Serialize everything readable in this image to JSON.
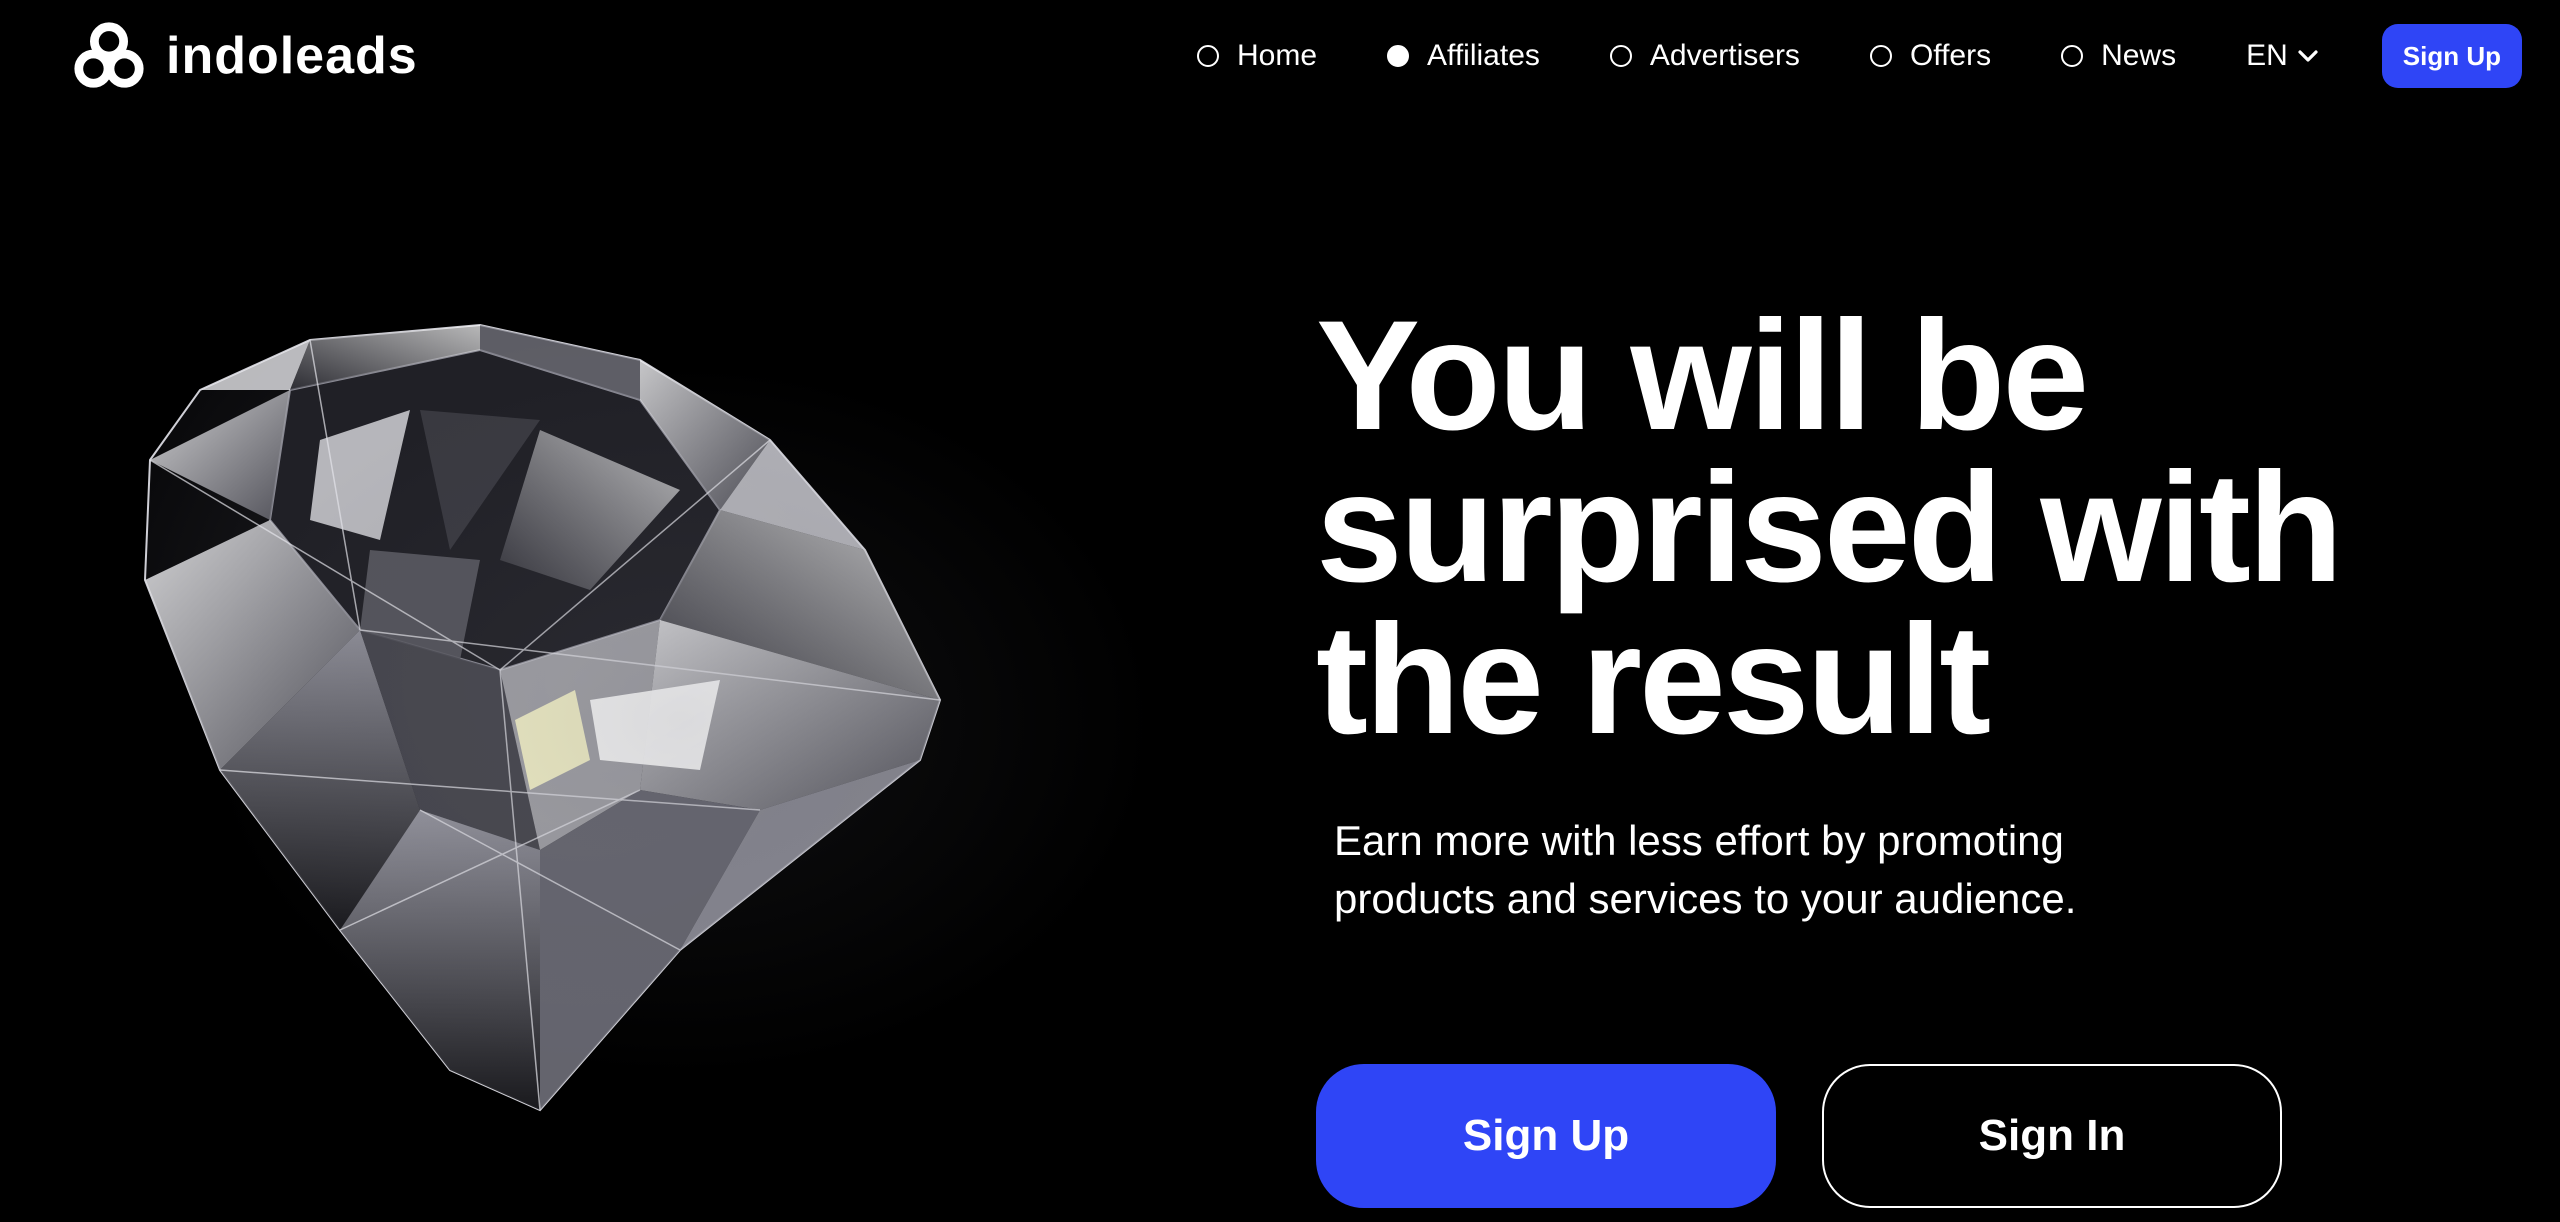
{
  "brand": {
    "name": "indoleads",
    "logo_icon": "triple-loop-icon"
  },
  "nav": {
    "items": [
      {
        "label": "Home",
        "active": false
      },
      {
        "label": "Affiliates",
        "active": true
      },
      {
        "label": "Advertisers",
        "active": false
      },
      {
        "label": "Offers",
        "active": false
      },
      {
        "label": "News",
        "active": false
      }
    ],
    "language": "EN",
    "signup_label": "Sign Up"
  },
  "hero": {
    "title": "You will be surprised with the result",
    "subtitle": "Earn more with less effort by promoting products and services to your audience.",
    "primary_button": "Sign Up",
    "secondary_button": "Sign In",
    "image": "diamond"
  },
  "colors": {
    "accent": "#2f45f6",
    "background": "#000000",
    "text": "#ffffff"
  }
}
